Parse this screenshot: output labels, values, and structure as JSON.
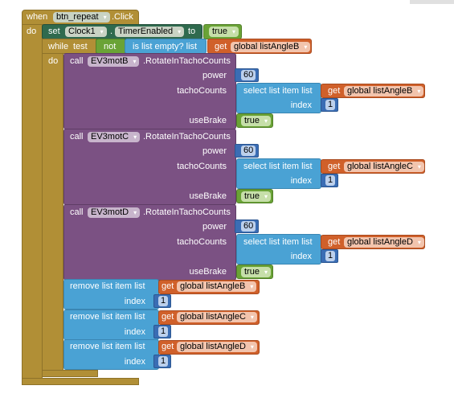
{
  "event": {
    "when": "when",
    "component": "btn_repeat",
    "event": ".Click",
    "do": "do"
  },
  "set_block": {
    "set": "set",
    "component": "Clock1",
    "dot": ".",
    "property": "TimerEnabled",
    "to": "to",
    "value": "true"
  },
  "while_block": {
    "while": "while",
    "test": "test",
    "do": "do",
    "not": "not",
    "is_empty": "is list empty?  list",
    "get": "get",
    "variable": "global listAngleB"
  },
  "calls": [
    {
      "call": "call",
      "motor": "EV3motB",
      "method": ".RotateInTachoCounts",
      "power_label": "power",
      "power": "60",
      "tacho_label": "tachoCounts",
      "select": "select list item  list",
      "get": "get",
      "variable": "global listAngleB",
      "index_label": "index",
      "index": "1",
      "brake_label": "useBrake",
      "brake": "true"
    },
    {
      "call": "call",
      "motor": "EV3motC",
      "method": ".RotateInTachoCounts",
      "power_label": "power",
      "power": "60",
      "tacho_label": "tachoCounts",
      "select": "select list item  list",
      "get": "get",
      "variable": "global listAngleC",
      "index_label": "index",
      "index": "1",
      "brake_label": "useBrake",
      "brake": "true"
    },
    {
      "call": "call",
      "motor": "EV3motD",
      "method": ".RotateInTachoCounts",
      "power_label": "power",
      "power": "60",
      "tacho_label": "tachoCounts",
      "select": "select list item  list",
      "get": "get",
      "variable": "global listAngleD",
      "index_label": "index",
      "index": "1",
      "brake_label": "useBrake",
      "brake": "true"
    }
  ],
  "removes": [
    {
      "label": "remove list item  list",
      "get": "get",
      "variable": "global listAngleB",
      "index_label": "index",
      "index": "1"
    },
    {
      "label": "remove list item  list",
      "get": "get",
      "variable": "global listAngleC",
      "index_label": "index",
      "index": "1"
    },
    {
      "label": "remove list item  list",
      "get": "get",
      "variable": "global listAngleD",
      "index_label": "index",
      "index": "1"
    }
  ],
  "colors": {
    "control": "#b18f36",
    "procedure": "#7b5183",
    "list": "#4aa2d4",
    "variable": "#d0602a",
    "logic": "#6aa336",
    "math": "#3a6db4"
  }
}
